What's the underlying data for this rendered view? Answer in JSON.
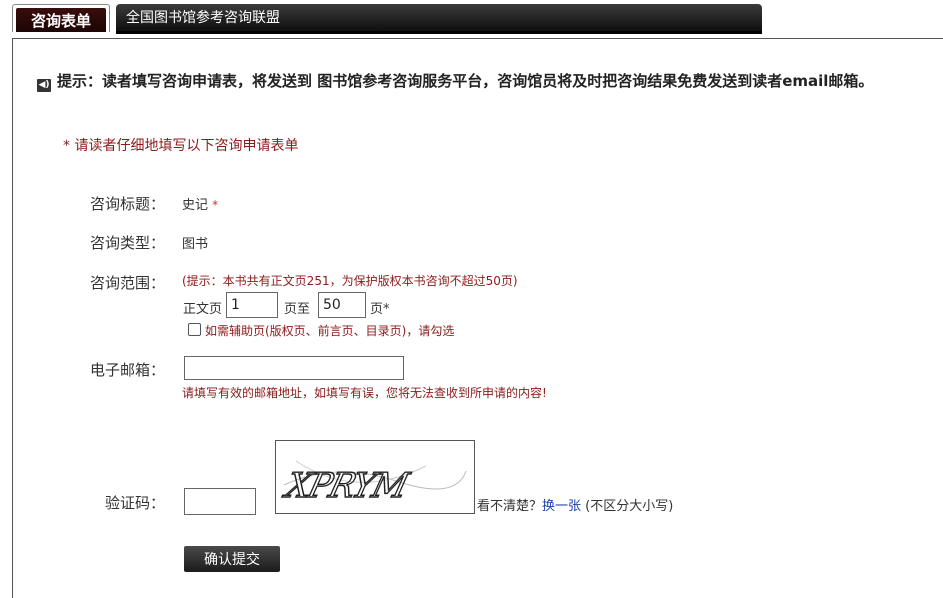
{
  "tabs": {
    "active_label": "咨询表单",
    "title": "全国图书馆参考咨询联盟"
  },
  "notice": {
    "icon": "speaker-icon",
    "text": "提示：读者填写咨询申请表，将发送到 图书馆参考咨询服务平台，咨询馆员将及时把咨询结果免费发送到读者email邮箱。"
  },
  "subnote": "* 请读者仔细地填写以下咨询申请表单",
  "form": {
    "title_label": "咨询标题：",
    "title_value": "史记",
    "required_mark": "*",
    "type_label": "咨询类型：",
    "type_value": "图书",
    "range_label": "咨询范围：",
    "range_hint": "(提示：本书共有正文页251，为保护版权本书咨询不超过50页)",
    "page_prefix": "正文页",
    "page_from": "1",
    "page_mid": "页至",
    "page_to": "50",
    "page_suffix": "页*",
    "aux_checkbox_label": "如需辅助页(版权页、前言页、目录页)，请勾选",
    "email_label": "电子邮箱：",
    "email_value": "",
    "email_hint": "请填写有效的邮箱地址，如填写有误，您将无法查收到所申请的内容!",
    "captcha_label": "验证码：",
    "captcha_value": "",
    "captcha_text": "XPRYM",
    "captcha_prompt": "看不清楚？",
    "captcha_refresh": "换一张",
    "captcha_case_note": "(不区分大小写)",
    "submit_label": "确认提交"
  },
  "colors": {
    "accent_red": "#8b1a1a",
    "link_blue": "#1a3fb0",
    "dark_bar": "#111111"
  }
}
